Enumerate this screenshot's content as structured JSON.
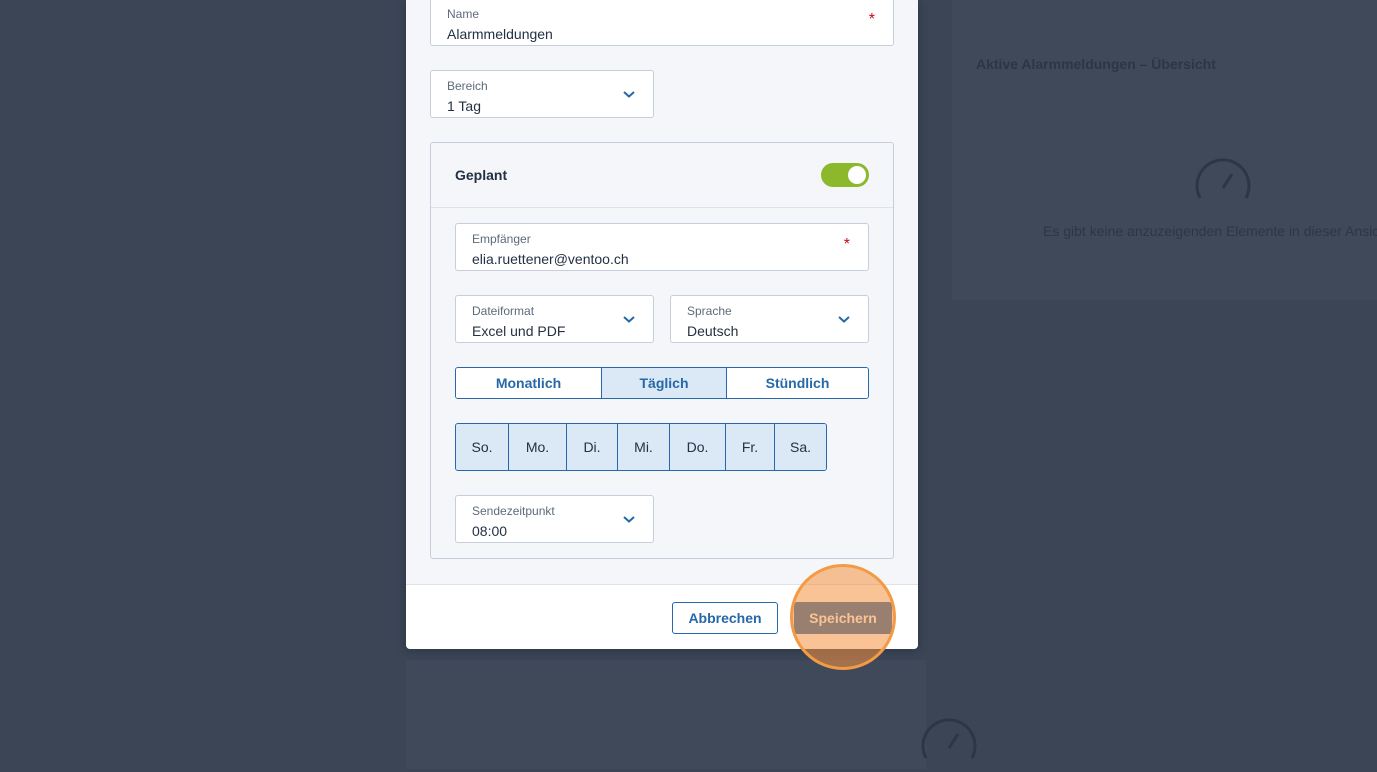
{
  "background": {
    "panel_title": "Aktive Alarmmeldungen – Übersicht",
    "empty_message": "Es gibt keine anzuzeigenden Elemente in dieser Ansicht"
  },
  "form": {
    "name": {
      "label": "Name",
      "value": "Alarmmeldungen",
      "required_mark": "*"
    },
    "range": {
      "label": "Bereich",
      "value": "1 Tag"
    },
    "scheduled": {
      "title": "Geplant",
      "toggle_on": true,
      "recipient": {
        "label": "Empfänger",
        "value": "elia.ruettener@ventoo.ch",
        "required_mark": "*"
      },
      "file_format": {
        "label": "Dateiformat",
        "value": "Excel und PDF"
      },
      "language": {
        "label": "Sprache",
        "value": "Deutsch"
      },
      "frequency": {
        "options": [
          "Monatlich",
          "Täglich",
          "Stündlich"
        ],
        "selected": "Täglich"
      },
      "days": [
        "So.",
        "Mo.",
        "Di.",
        "Mi.",
        "Do.",
        "Fr.",
        "Sa."
      ],
      "send_time": {
        "label": "Sendezeitpunkt",
        "value": "08:00"
      }
    }
  },
  "footer": {
    "cancel_label": "Abbrechen",
    "save_label": "Speichern"
  },
  "colors": {
    "accent": "#2668a8",
    "toggle": "#8cb82c",
    "required": "#d0021b",
    "highlight": "#f39a45"
  }
}
